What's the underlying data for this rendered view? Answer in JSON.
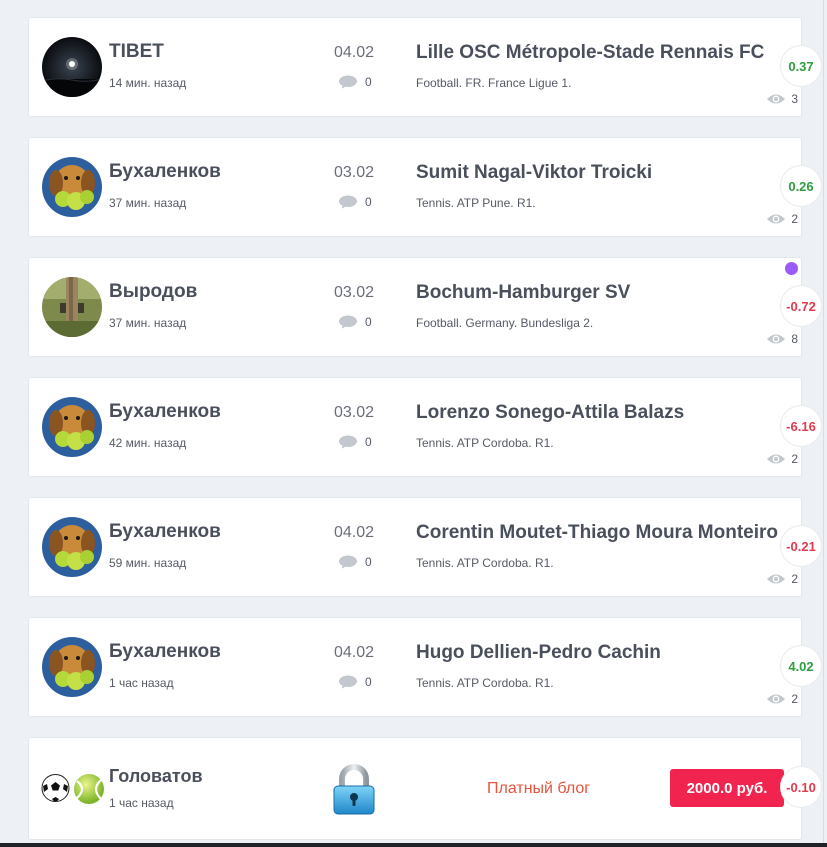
{
  "colors": {
    "positive": "#2f9e3e",
    "negative": "#e23a4f",
    "paid_label": "#e8533c",
    "price_button": "#f0244e"
  },
  "posts": [
    {
      "author": "TIBET",
      "time": "14 мин. назад",
      "date": "04.02",
      "comments": "0",
      "match": "Lille OSC Métropole-Stade Rennais FC",
      "league": "Football. FR. France Ligue 1.",
      "views": "3",
      "profit": "0.37",
      "avatar": "moon-avatar"
    },
    {
      "author": "Бухаленков",
      "time": "37 мин. назад",
      "date": "03.02",
      "comments": "0",
      "match": "Sumit Nagal-Viktor Troicki",
      "league": "Tennis. ATP Pune. R1.",
      "views": "2",
      "profit": "0.26",
      "avatar": "dog-avatar"
    },
    {
      "author": "Выродов",
      "time": "37 мин. назад",
      "date": "03.02",
      "comments": "0",
      "match": "Bochum-Hamburger SV",
      "league": "Football. Germany. Bundesliga 2.",
      "views": "8",
      "profit": "-0.72",
      "avatar": "tree-avatar"
    },
    {
      "author": "Бухаленков",
      "time": "42 мин. назад",
      "date": "03.02",
      "comments": "0",
      "match": "Lorenzo Sonego-Attila Balazs",
      "league": "Tennis. ATP Cordoba. R1.",
      "views": "2",
      "profit": "-6.16",
      "avatar": "dog-avatar"
    },
    {
      "author": "Бухаленков",
      "time": "59 мин. назад",
      "date": "04.02",
      "comments": "0",
      "match": "Corentin Moutet-Thiago Moura Monteiro",
      "league": "Tennis. ATP Cordoba. R1.",
      "views": "2",
      "profit": "-0.21",
      "avatar": "dog-avatar"
    },
    {
      "author": "Бухаленков",
      "time": "1 час назад",
      "date": "04.02",
      "comments": "0",
      "match": "Hugo Dellien-Pedro Cachin",
      "league": "Tennis. ATP Cordoba. R1.",
      "views": "2",
      "profit": "4.02",
      "avatar": "dog-avatar"
    }
  ],
  "paid_post": {
    "author": "Головатов",
    "time": "1 час назад",
    "paid_label": "Платный блог",
    "price": "2000.0 руб.",
    "profit": "-0.10",
    "icons": [
      "soccer-ball-icon",
      "tennis-ball-icon",
      "lock-icon"
    ]
  }
}
